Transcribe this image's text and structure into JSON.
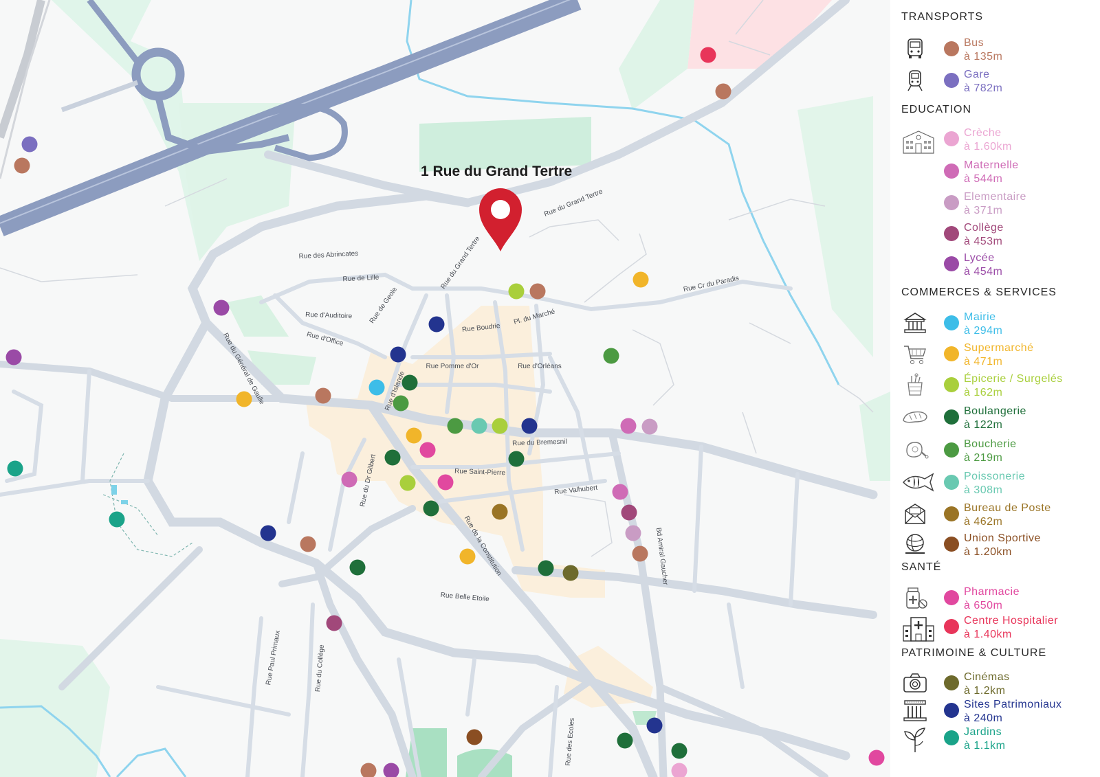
{
  "address_label": "1 Rue du Grand Tertre",
  "streets": [
    "Rue des Abrincates",
    "Rue de Lille",
    "Rue de Geole",
    "Rue d'Auditoire",
    "Rue d'Office",
    "Rue du Grand Tertre",
    "Rue du Grand Tertre",
    "Rue Boudrie",
    "Pl. du Marché",
    "Rue Pomme d'Or",
    "Rue d'Orléans",
    "Rue d'Islande",
    "Rue Cr du Paradis",
    "Rue du Général de Gaulle",
    "Rue du Bremesnil",
    "Rue Saint-Pierre",
    "Rue Valhubert",
    "Rue du Dr Gilbert",
    "Rue de la Constitution",
    "Bd Amiral Gaucher",
    "Rue Belle Etoile",
    "Rue Paul Primaux",
    "Rue du Collège",
    "Rue des Ecoles"
  ],
  "legend": [
    {
      "title": "TRANSPORTS",
      "items": [
        {
          "icon": "bus-icon",
          "name": "Bus",
          "distance": "à 135m",
          "color": "#b9775f"
        },
        {
          "icon": "train-icon",
          "name": "Gare",
          "distance": "à 782m",
          "color": "#7b6fc0"
        }
      ]
    },
    {
      "title": "EDUCATION",
      "items": [
        {
          "icon": "school-icon",
          "name": "Crèche",
          "distance": "à 1.60km",
          "color": "#eba5d2"
        },
        {
          "icon": "",
          "name": "Maternelle",
          "distance": "à 544m",
          "color": "#cf6bb6"
        },
        {
          "icon": "",
          "name": "Elementaire",
          "distance": "à 371m",
          "color": "#c99cc4"
        },
        {
          "icon": "",
          "name": "Collège",
          "distance": "à 453m",
          "color": "#a1487a"
        },
        {
          "icon": "",
          "name": "Lycée",
          "distance": "à 454m",
          "color": "#9a4aa6"
        }
      ]
    },
    {
      "title": "COMMERCES & SERVICES",
      "items": [
        {
          "icon": "town-hall-icon",
          "name": "Mairie",
          "distance": "à 294m",
          "color": "#3dbde8"
        },
        {
          "icon": "cart-icon",
          "name": "Supermarché",
          "distance": "à 471m",
          "color": "#f1b52a"
        },
        {
          "icon": "grocery-icon",
          "name": "Épicerie / Surgelés",
          "distance": "à 162m",
          "color": "#a9cf3c"
        },
        {
          "icon": "bread-icon",
          "name": "Boulangerie",
          "distance": "à 122m",
          "color": "#1f6f3a"
        },
        {
          "icon": "meat-icon",
          "name": "Boucherie",
          "distance": "à 219m",
          "color": "#4c9a42"
        },
        {
          "icon": "fish-icon",
          "name": "Poissonerie",
          "distance": "à 308m",
          "color": "#69c9b1"
        },
        {
          "icon": "mail-icon",
          "name": "Bureau de Poste",
          "distance": "à 462m",
          "color": "#9a7425"
        },
        {
          "icon": "sports-ball-icon",
          "name": "Union Sportive",
          "distance": "à 1.20km",
          "color": "#8a4e22"
        }
      ]
    },
    {
      "title": "SANTÉ",
      "items": [
        {
          "icon": "pharmacy-icon",
          "name": "Pharmacie",
          "distance": "à 650m",
          "color": "#e1489f"
        },
        {
          "icon": "hospital-icon",
          "name": "Centre Hospitalier",
          "distance": "à 1.40km",
          "color": "#e8355a"
        }
      ]
    },
    {
      "title": "PATRIMOINE & CULTURE",
      "items": [
        {
          "icon": "camera-icon",
          "name": "Cinémas",
          "distance": "à 1.2km",
          "color": "#6d6a2c"
        },
        {
          "icon": "monument-icon",
          "name": "Sites Patrimoniaux",
          "distance": "à 240m",
          "color": "#23348f"
        },
        {
          "icon": "plant-icon",
          "name": "Jardins",
          "distance": "à 1.1km",
          "color": "#1aa389"
        }
      ]
    }
  ],
  "pois": [
    {
      "type": "hospital",
      "color": "#e8355a"
    },
    {
      "type": "bus",
      "color": "#b9775f"
    },
    {
      "type": "gare",
      "color": "#7b6fc0"
    },
    {
      "type": "bus",
      "color": "#b9775f"
    },
    {
      "type": "supermarche",
      "color": "#f1b52a"
    },
    {
      "type": "epicerie",
      "color": "#a9cf3c"
    },
    {
      "type": "bus",
      "color": "#b9775f"
    },
    {
      "type": "lycee",
      "color": "#9a4aa6"
    },
    {
      "type": "lycee",
      "color": "#9a4aa6"
    },
    {
      "type": "sites",
      "color": "#23348f"
    },
    {
      "type": "sites",
      "color": "#23348f"
    },
    {
      "type": "boucherie",
      "color": "#4c9a42"
    },
    {
      "type": "mairie",
      "color": "#3dbde8"
    },
    {
      "type": "boulangerie",
      "color": "#1f6f3a"
    },
    {
      "type": "boucherie",
      "color": "#4c9a42"
    },
    {
      "type": "bus",
      "color": "#b9775f"
    },
    {
      "type": "supermarche",
      "color": "#f1b52a"
    },
    {
      "type": "jardins",
      "color": "#1aa389"
    },
    {
      "type": "boucherie",
      "color": "#4c9a42"
    },
    {
      "type": "poissonerie",
      "color": "#69c9b1"
    },
    {
      "type": "epicerie",
      "color": "#a9cf3c"
    },
    {
      "type": "sites",
      "color": "#23348f"
    },
    {
      "type": "maternelle",
      "color": "#cf6bb6"
    },
    {
      "type": "elementaire",
      "color": "#c99cc4"
    },
    {
      "type": "supermarche",
      "color": "#f1b52a"
    },
    {
      "type": "pharmacie",
      "color": "#e1489f"
    },
    {
      "type": "boulangerie",
      "color": "#1f6f3a"
    },
    {
      "type": "boulangerie",
      "color": "#1f6f3a"
    },
    {
      "type": "maternelle",
      "color": "#cf6bb6"
    },
    {
      "type": "epicerie",
      "color": "#a9cf3c"
    },
    {
      "type": "pharmacie",
      "color": "#e1489f"
    },
    {
      "type": "boulangerie",
      "color": "#1f6f3a"
    },
    {
      "type": "poste",
      "color": "#9a7425"
    },
    {
      "type": "maternelle",
      "color": "#cf6bb6"
    },
    {
      "type": "college",
      "color": "#a1487a"
    },
    {
      "type": "elementaire",
      "color": "#c99cc4"
    },
    {
      "type": "bus",
      "color": "#b9775f"
    },
    {
      "type": "jardins",
      "color": "#1aa389"
    },
    {
      "type": "sites",
      "color": "#23348f"
    },
    {
      "type": "bus",
      "color": "#b9775f"
    },
    {
      "type": "boulangerie",
      "color": "#1f6f3a"
    },
    {
      "type": "supermarche",
      "color": "#f1b52a"
    },
    {
      "type": "boulangerie",
      "color": "#1f6f3a"
    },
    {
      "type": "cinema",
      "color": "#6d6a2c"
    },
    {
      "type": "college",
      "color": "#a1487a"
    },
    {
      "type": "sites",
      "color": "#23348f"
    },
    {
      "type": "boulangerie",
      "color": "#1f6f3a"
    },
    {
      "type": "boulangerie",
      "color": "#1f6f3a"
    },
    {
      "type": "sport",
      "color": "#8a4e22"
    },
    {
      "type": "bus",
      "color": "#b9775f"
    },
    {
      "type": "lycee",
      "color": "#9a4aa6"
    },
    {
      "type": "creche",
      "color": "#eba5d2"
    },
    {
      "type": "pharmacie",
      "color": "#e1489f"
    }
  ]
}
